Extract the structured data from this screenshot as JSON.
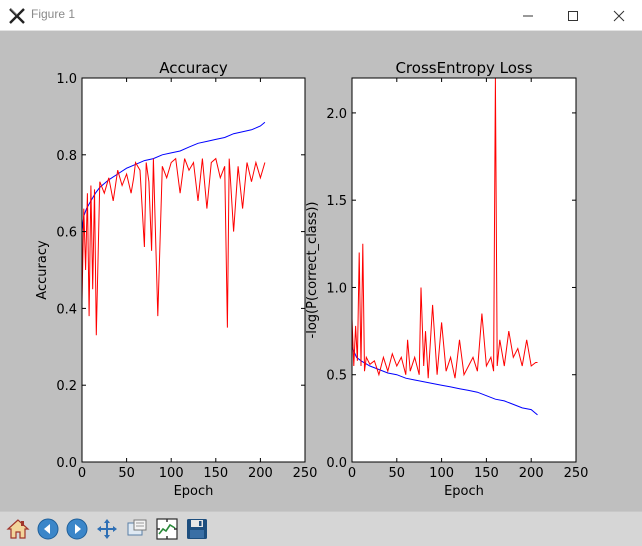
{
  "window": {
    "title": "Figure 1",
    "minimize_icon": "minimize-icon",
    "maximize_icon": "maximize-icon",
    "close_icon": "close-icon"
  },
  "toolbar": {
    "buttons": [
      {
        "name": "home-button",
        "icon": "home-icon"
      },
      {
        "name": "back-button",
        "icon": "arrow-left-icon"
      },
      {
        "name": "forward-button",
        "icon": "arrow-right-icon"
      },
      {
        "name": "pan-button",
        "icon": "move-arrows-icon"
      },
      {
        "name": "zoom-button",
        "icon": "zoom-rect-icon"
      },
      {
        "name": "configure-subplots-button",
        "icon": "subplots-icon"
      },
      {
        "name": "save-button",
        "icon": "floppy-disk-icon"
      }
    ]
  },
  "colors": {
    "train": "#0000ff",
    "validation": "#ff0000"
  },
  "chart_data": [
    {
      "type": "line",
      "title": "Accuracy",
      "xlabel": "Epoch",
      "ylabel": "Accuracy",
      "xlim": [
        0,
        250
      ],
      "ylim": [
        0.0,
        1.0
      ],
      "xticks": [
        "0",
        "50",
        "100",
        "150",
        "200",
        "250"
      ],
      "yticks": [
        "0.0",
        "0.2",
        "0.4",
        "0.6",
        "0.8",
        "1.0"
      ],
      "grid": false,
      "series": [
        {
          "color": "#0000ff",
          "x": [
            0,
            2,
            5,
            10,
            15,
            20,
            30,
            40,
            50,
            60,
            70,
            80,
            90,
            100,
            110,
            120,
            130,
            140,
            150,
            160,
            170,
            180,
            190,
            200,
            205
          ],
          "y": [
            0.6,
            0.64,
            0.66,
            0.68,
            0.7,
            0.715,
            0.735,
            0.75,
            0.765,
            0.775,
            0.785,
            0.79,
            0.8,
            0.805,
            0.81,
            0.82,
            0.83,
            0.835,
            0.84,
            0.845,
            0.855,
            0.86,
            0.865,
            0.875,
            0.885
          ]
        },
        {
          "color": "#ff0000",
          "x": [
            0,
            2,
            4,
            6,
            8,
            10,
            12,
            14,
            16,
            20,
            25,
            30,
            35,
            40,
            45,
            50,
            55,
            58,
            60,
            65,
            70,
            72,
            75,
            78,
            80,
            85,
            90,
            95,
            100,
            105,
            110,
            115,
            120,
            125,
            130,
            135,
            140,
            145,
            150,
            155,
            160,
            163,
            165,
            170,
            175,
            180,
            185,
            190,
            195,
            200,
            205
          ],
          "y": [
            0.42,
            0.66,
            0.5,
            0.7,
            0.38,
            0.72,
            0.45,
            0.71,
            0.33,
            0.73,
            0.7,
            0.74,
            0.68,
            0.76,
            0.72,
            0.75,
            0.7,
            0.74,
            0.78,
            0.76,
            0.56,
            0.78,
            0.73,
            0.55,
            0.79,
            0.38,
            0.77,
            0.74,
            0.78,
            0.79,
            0.7,
            0.79,
            0.76,
            0.78,
            0.68,
            0.79,
            0.66,
            0.78,
            0.79,
            0.74,
            0.77,
            0.35,
            0.79,
            0.6,
            0.77,
            0.66,
            0.78,
            0.73,
            0.78,
            0.74,
            0.78
          ]
        }
      ]
    },
    {
      "type": "line",
      "title": "CrossEntropy Loss",
      "xlabel": "Epoch",
      "ylabel": "-log(P(correct_class))",
      "xlim": [
        0,
        250
      ],
      "ylim": [
        0.0,
        2.2
      ],
      "xticks": [
        "0",
        "50",
        "100",
        "150",
        "200",
        "250"
      ],
      "yticks": [
        "0.0",
        "0.5",
        "1.0",
        "1.5",
        "2.0"
      ],
      "ytick_values": [
        0.0,
        0.5,
        1.0,
        1.5,
        2.0
      ],
      "grid": false,
      "series": [
        {
          "color": "#0000ff",
          "x": [
            0,
            5,
            10,
            20,
            30,
            40,
            50,
            60,
            70,
            80,
            90,
            100,
            110,
            120,
            130,
            140,
            150,
            160,
            170,
            180,
            190,
            200,
            207
          ],
          "y": [
            0.66,
            0.6,
            0.58,
            0.55,
            0.53,
            0.51,
            0.5,
            0.48,
            0.47,
            0.46,
            0.45,
            0.44,
            0.43,
            0.42,
            0.41,
            0.4,
            0.38,
            0.36,
            0.35,
            0.33,
            0.31,
            0.3,
            0.27
          ]
        },
        {
          "color": "#ff0000",
          "x": [
            0,
            2,
            4,
            6,
            8,
            10,
            12,
            14,
            16,
            20,
            25,
            30,
            35,
            40,
            45,
            50,
            55,
            60,
            62,
            65,
            70,
            75,
            77,
            80,
            82,
            85,
            90,
            95,
            100,
            105,
            110,
            115,
            120,
            125,
            130,
            135,
            140,
            145,
            150,
            155,
            158,
            160,
            162,
            165,
            170,
            175,
            180,
            185,
            190,
            195,
            200,
            205,
            207
          ],
          "y": [
            0.82,
            0.55,
            0.78,
            0.58,
            1.2,
            0.55,
            1.25,
            0.52,
            0.6,
            0.56,
            0.58,
            0.5,
            0.6,
            0.52,
            0.62,
            0.55,
            0.6,
            0.5,
            0.7,
            0.52,
            0.6,
            0.5,
            1.0,
            0.55,
            0.75,
            0.48,
            0.9,
            0.5,
            0.8,
            0.52,
            0.6,
            0.48,
            0.7,
            0.5,
            0.55,
            0.6,
            0.52,
            0.85,
            0.55,
            0.6,
            0.52,
            2.2,
            0.55,
            0.7,
            0.55,
            0.75,
            0.6,
            0.65,
            0.55,
            0.7,
            0.55,
            0.57,
            0.57
          ]
        }
      ]
    }
  ]
}
